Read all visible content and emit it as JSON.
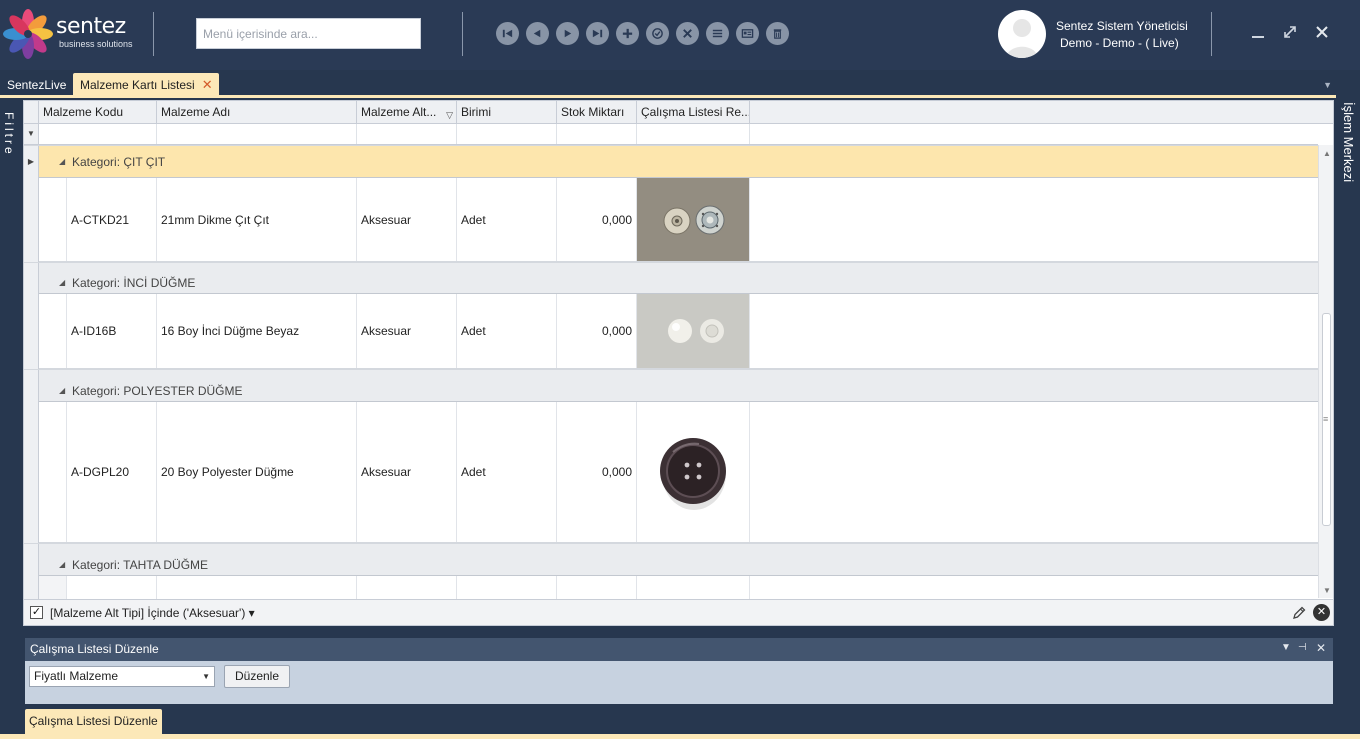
{
  "app": {
    "brand": "sentez",
    "brand_sub": "business solutions",
    "search_placeholder": "Menü içerisinde ara..."
  },
  "toolbar": {
    "buttons": [
      "first-record",
      "previous-record",
      "next-record",
      "last-record",
      "add",
      "approve",
      "cancel",
      "list",
      "card-view",
      "delete"
    ]
  },
  "user": {
    "name": "Sentez Sistem Yöneticisi",
    "company": "Demo - Demo - ( Live)"
  },
  "tabs": {
    "home": "SentezLive",
    "active": "Malzeme Kartı Listesi",
    "close": "✕"
  },
  "side": {
    "left": "Filtre",
    "right": "İşlem Merkezi"
  },
  "grid": {
    "columns": [
      "Malzeme Kodu",
      "Malzeme Adı",
      "Malzeme Alt...",
      "Birimi",
      "Stok Miktarı",
      "Çalışma Listesi Re..."
    ],
    "groups": [
      {
        "label": "Kategori: ÇIT ÇIT",
        "row": {
          "code": "A-CTKD21",
          "name": "21mm Dikme Çıt Çıt",
          "subtype": "Aksesuar",
          "unit": "Adet",
          "stock": "0,000",
          "image": "snap-button-image"
        }
      },
      {
        "label": "Kategori: İNCİ DÜĞME",
        "row": {
          "code": "A-ID16B",
          "name": "16 Boy İnci Düğme Beyaz",
          "subtype": "Aksesuar",
          "unit": "Adet",
          "stock": "0,000",
          "image": "pearl-button-image"
        }
      },
      {
        "label": "Kategori: POLYESTER DÜĞME",
        "row": {
          "code": "A-DGPL20",
          "name": "20 Boy Polyester Düğme",
          "subtype": "Aksesuar",
          "unit": "Adet",
          "stock": "0,000",
          "image": "polyester-button-image"
        }
      },
      {
        "label": "Kategori: TAHTA DÜĞME"
      }
    ],
    "filter_text": "[Malzeme Alt Tipi] İçinde ('Aksesuar') ▾",
    "filter_checked": "✓"
  },
  "bottom_panel": {
    "title": "Çalışma Listesi Düzenle",
    "select_value": "Fiyatlı Malzeme",
    "button_label": "Düzenle",
    "tab_label": "Çalışma Listesi Düzenle"
  },
  "colors": {
    "header_bg": "#2a3a55",
    "accent_tab": "#fce8b8",
    "group_highlight": "#fde6ad"
  }
}
